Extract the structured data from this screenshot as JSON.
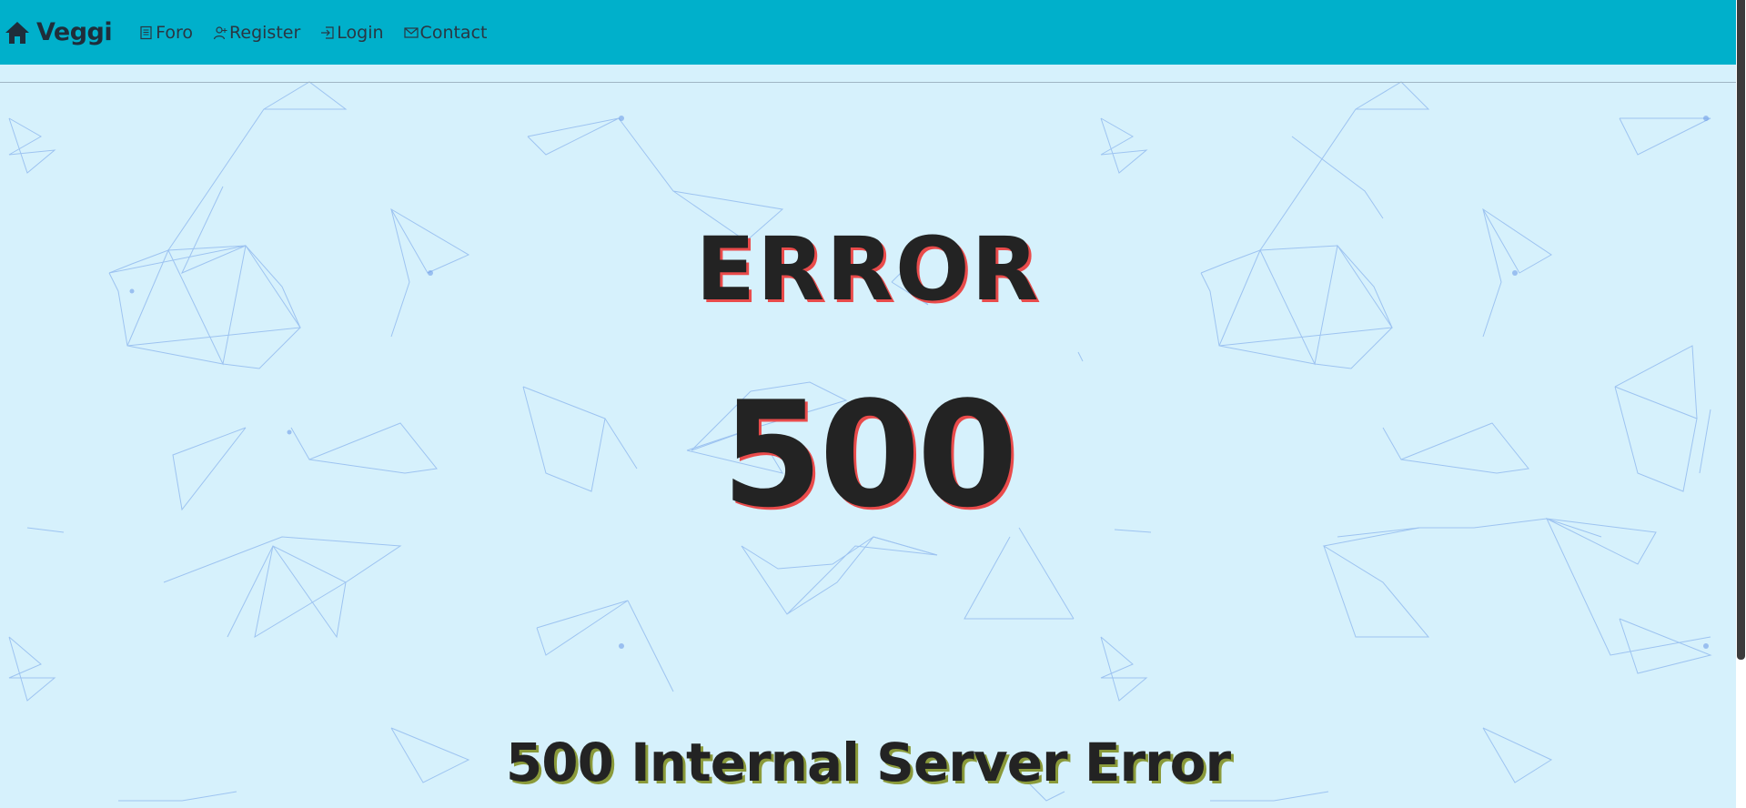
{
  "colors": {
    "navbar_bg": "#00b0cb",
    "page_bg": "#d6f1fc",
    "heading_text": "#232323",
    "heading_shadow_red": "#e94b4b",
    "message_shadow_olive": "#8a9a3a",
    "network_lines": "#6f9ee8"
  },
  "navbar": {
    "brand": {
      "icon": "home-icon",
      "label": "Veggi"
    },
    "items": [
      {
        "icon": "document-icon",
        "label": "Foro"
      },
      {
        "icon": "user-add-icon",
        "label": "Register"
      },
      {
        "icon": "login-icon",
        "label": "Login"
      },
      {
        "icon": "mail-icon",
        "label": "Contact"
      }
    ]
  },
  "main": {
    "heading": "ERROR",
    "code": "500",
    "message": "500 Internal Server Error"
  }
}
